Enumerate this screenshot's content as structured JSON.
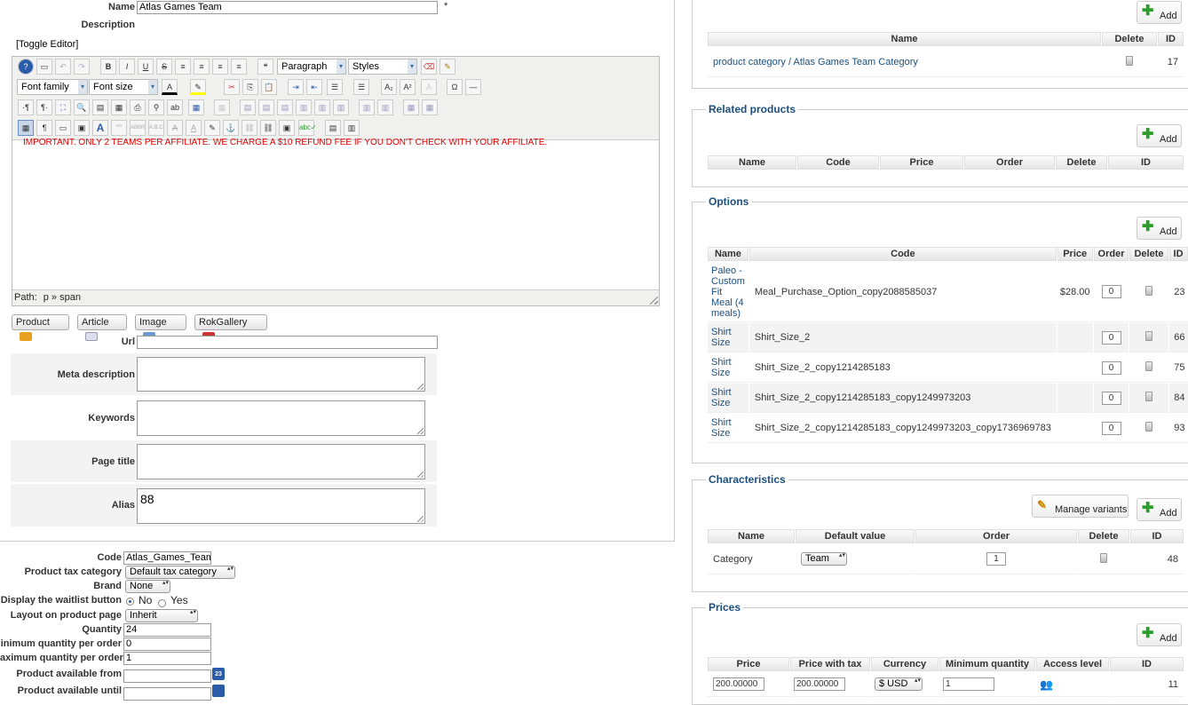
{
  "form": {
    "name_label": "Name",
    "name_value": "Atlas Games Team",
    "required_mark": "*",
    "description_label": "Description",
    "toggle_editor": "[Toggle Editor]",
    "format_select": "Paragraph",
    "styles_select": "Styles",
    "font_family_select": "Font family",
    "font_size_select": "Font size",
    "editor_text": "IMPORTANT.  ONLY 2 TEAMS PER AFFILIATE.  WE CHARGE A $10 REFUND FEE IF YOU DON'T CHECK WITH YOUR AFFILIATE.",
    "path_label": "Path:",
    "path_value": "p » span",
    "insert_buttons": [
      "Product",
      "Article",
      "Image",
      "RokGallery"
    ],
    "url_label": "Url",
    "meta_description_label": "Meta description",
    "keywords_label": "Keywords",
    "page_title_label": "Page title",
    "alias_label": "Alias",
    "alias_value": "88"
  },
  "details": {
    "code_label": "Code",
    "code_value": "Atlas_Games_Team",
    "tax_label": "Product tax category",
    "tax_value": "Default tax category",
    "brand_label": "Brand",
    "brand_value": "None",
    "waitlist_label": "Display the waitlist button",
    "waitlist_no": "No",
    "waitlist_yes": "Yes",
    "layout_label": "Layout on product page",
    "layout_value": "Inherit",
    "quantity_label": "Quantity",
    "quantity_value": "24",
    "min_qty_label": "inimum quantity per order",
    "min_qty_value": "0",
    "max_qty_label": "aximum quantity per order",
    "max_qty_value": "1",
    "avail_from_label": "Product available from",
    "avail_until_label": "Product available until"
  },
  "categories_panel": {
    "add_label": "Add",
    "headers": [
      "Name",
      "Delete",
      "ID"
    ],
    "rows": [
      {
        "name": "product category / Atlas Games Team Category",
        "id": "17"
      }
    ]
  },
  "related_panel": {
    "title": "Related products",
    "add_label": "Add",
    "headers": [
      "Name",
      "Code",
      "Price",
      "Order",
      "Delete",
      "ID"
    ]
  },
  "options_panel": {
    "title": "Options",
    "add_label": "Add",
    "headers": [
      "Name",
      "Code",
      "Price",
      "Order",
      "Delete",
      "ID"
    ],
    "rows": [
      {
        "name": "Paleo - Custom Fit Meal (4 meals)",
        "code": "Meal_Purchase_Option_copy2088585037",
        "price": "$28.00",
        "order": "0",
        "id": "23"
      },
      {
        "name": "Shirt Size",
        "code": "Shirt_Size_2",
        "price": "",
        "order": "0",
        "id": "66"
      },
      {
        "name": "Shirt Size",
        "code": "Shirt_Size_2_copy1214285183",
        "price": "",
        "order": "0",
        "id": "75"
      },
      {
        "name": "Shirt Size",
        "code": "Shirt_Size_2_copy1214285183_copy1249973203",
        "price": "",
        "order": "0",
        "id": "84"
      },
      {
        "name": "Shirt Size",
        "code": "Shirt_Size_2_copy1214285183_copy1249973203_copy1736969783",
        "price": "",
        "order": "0",
        "id": "93"
      }
    ]
  },
  "characteristics_panel": {
    "title": "Characteristics",
    "manage_label": "Manage variants",
    "add_label": "Add",
    "headers": [
      "Name",
      "Default value",
      "Order",
      "Delete",
      "ID"
    ],
    "rows": [
      {
        "name": "Category",
        "value": "Team",
        "order": "1",
        "id": "48"
      }
    ]
  },
  "prices_panel": {
    "title": "Prices",
    "add_label": "Add",
    "headers": [
      "Price",
      "Price with tax",
      "Currency",
      "Minimum quantity",
      "Access level",
      "ID"
    ],
    "rows": [
      {
        "price": "200.00000",
        "price_tax": "200.00000",
        "currency": "$ USD",
        "min_qty": "1",
        "id": "11"
      }
    ]
  }
}
